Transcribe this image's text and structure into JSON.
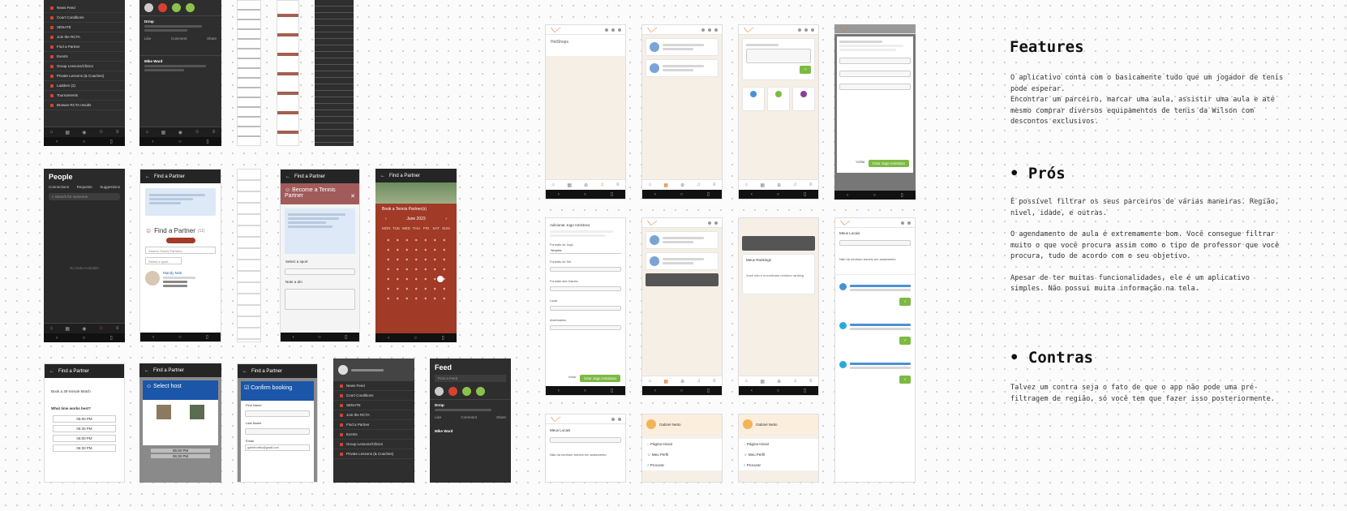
{
  "features": {
    "title": "Features",
    "paragraphs": [
      "O aplicativo conta com o basicamente tudo que um jogador de tenis pode esperar.",
      "Encontrar um parceiro, marcar uma aula, assistir uma aula e até mesmo comprar diversos equipamentos de tenis da Wilson com descontos exclusivos."
    ]
  },
  "pros": {
    "title": "• Prós",
    "paragraphs": [
      "É possível filtrar os seus parceiros de várias maneiras. Região, nivel, idade, e outras.",
      "O agendamento de aula é extremamente bom. Você consegue filtrar muito o que você procura assim como o tipo de professor que você procura, tudo de acordo com o seu objetivo.",
      "Apesar de ter muitas funcionalidades, ele é um aplicativo simples. Não possui muita informação na tela."
    ]
  },
  "contras": {
    "title": "• Contras",
    "paragraphs": [
      "Talvez um contra seja o fato de que o app não pode uma pré-filtragem de região, só você tem que fazer isso posteriormente."
    ]
  },
  "menu_items": [
    "News Feed",
    "Court Conditions",
    "SENATE",
    "Join the RCTA",
    "Find a Partner",
    "Events",
    "Group Lessons/Clinics",
    "Private Lessons (& Coaches)",
    "Ladders (2)",
    "Tournaments",
    "Browse RCTA results"
  ],
  "find_partner": {
    "header": "Find a Partner",
    "become_title": "Become a Tennis Partner",
    "find_title": "Find a Partner",
    "find_count": "(11)",
    "search_placeholder": "Search Tennis Partners",
    "select_sport": "Select a sport",
    "note": "Note a dm",
    "person_name": "Mandy Mak"
  },
  "people": {
    "title": "People",
    "tabs": [
      "Connections",
      "Requests",
      "Suggestions"
    ],
    "search_placeholder": "Search for someone",
    "empty": "No Data Available"
  },
  "calendar": {
    "title": "Book a Tennis Partner(s)",
    "month": "June 2023",
    "days": [
      "MON",
      "TUE",
      "WED",
      "THU",
      "FRI",
      "SAT",
      "SUN"
    ]
  },
  "feed": {
    "title": "Feed",
    "post_prompt": "Post a Feed",
    "user": "Drmp",
    "actions": [
      "Like",
      "Comment",
      "Share"
    ],
    "second_user": "Mike Ward"
  },
  "booking": {
    "select_host": "Select host",
    "confirm": "Confirm booking",
    "book_label": "Book a 30-minute Match",
    "time_question": "What time works best?",
    "times": [
      "05:00 PM",
      "05:30 PM",
      "06:00 PM",
      "06:30 PM"
    ],
    "fields": [
      "First Name",
      "Last Name",
      "Email"
    ],
    "email_value": "gabriel.netto@gmail.com"
  },
  "app": {
    "hot_title": "HotShops",
    "no_tournaments": "Não há nenhum torneio em andamento",
    "rankings": "Meus Rankings",
    "no_ranking": "Você não é encontrado nenhum ranking",
    "locais": "Meus Locais",
    "profile_name": "Gabriel Netto",
    "profile_items": [
      "Página Inicial",
      "Meu Perfil",
      "Procurar"
    ],
    "form_title": "Adicionar Jogo Amistoso",
    "form_labels": [
      "Formato do Jogo",
      "Formato do Set",
      "Formato dos Games",
      "Local",
      "Adversários"
    ],
    "form_select": "Simples",
    "cancel": "Voltar",
    "submit": "Criar Jogo Amistoso"
  },
  "colors": {
    "accent": "#e0702a",
    "dark": "#2e2e2e",
    "brick": "#a13a26",
    "green": "#7cba43"
  }
}
